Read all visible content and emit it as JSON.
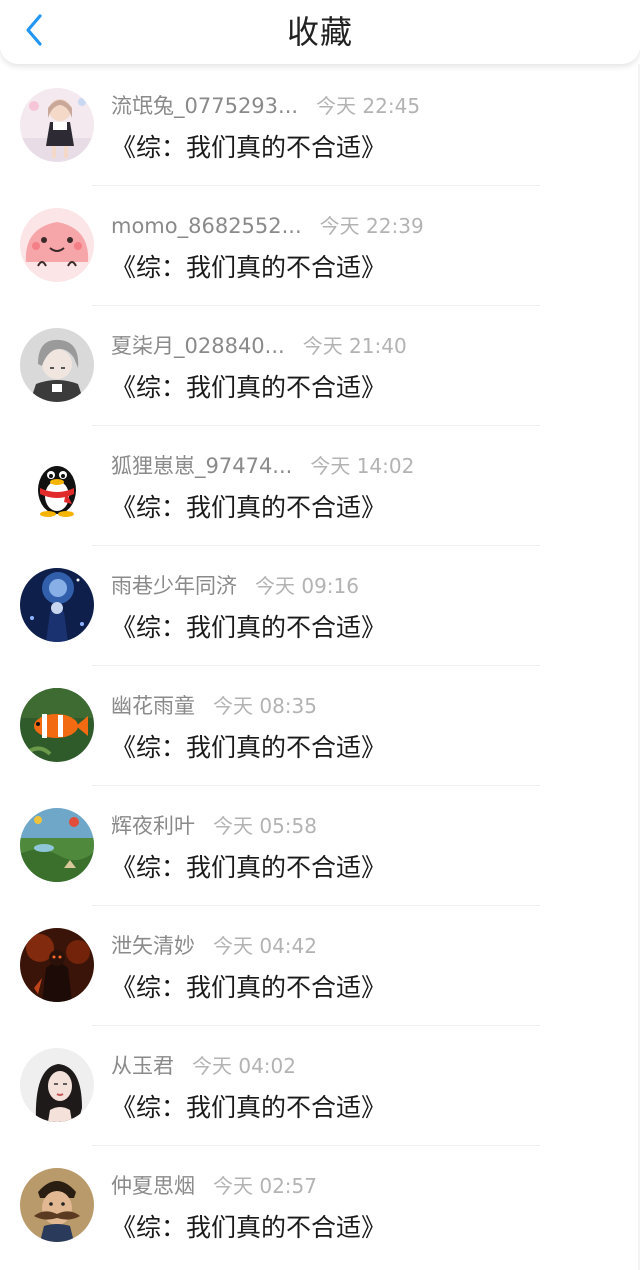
{
  "header": {
    "title": "收藏",
    "back_icon": "chevron-left-icon",
    "accent_color": "#2196f3"
  },
  "items": [
    {
      "name": "流氓兔_0775293...",
      "time": "今天 22:45",
      "book": "《综：我们真的不合适》",
      "avatar": "anime-girl"
    },
    {
      "name": "momo_8682552...",
      "time": "今天 22:39",
      "book": "《综：我们真的不合适》",
      "avatar": "pink-blob"
    },
    {
      "name": "夏柒月_028840...",
      "time": "今天 21:40",
      "book": "《综：我们真的不合适》",
      "avatar": "anime-boy-gray"
    },
    {
      "name": "狐狸崽崽_97474...",
      "time": "今天 14:02",
      "book": "《综：我们真的不合适》",
      "avatar": "qq-penguin"
    },
    {
      "name": "雨巷少年同济",
      "time": "今天 09:16",
      "book": "《综：我们真的不合适》",
      "avatar": "blue-night"
    },
    {
      "name": "幽花雨童",
      "time": "今天 08:35",
      "book": "《综：我们真的不合适》",
      "avatar": "clownfish"
    },
    {
      "name": "辉夜利叶",
      "time": "今天 05:58",
      "book": "《综：我们真的不合适》",
      "avatar": "landscape-balloons"
    },
    {
      "name": "泄矢清妙",
      "time": "今天 04:42",
      "book": "《综：我们真的不合适》",
      "avatar": "dark-warrior"
    },
    {
      "name": "从玉君",
      "time": "今天 04:02",
      "book": "《综：我们真的不合适》",
      "avatar": "woman-portrait"
    },
    {
      "name": "仲夏思烟",
      "time": "今天 02:57",
      "book": "《综：我们真的不合适》",
      "avatar": "mustache-man"
    }
  ]
}
